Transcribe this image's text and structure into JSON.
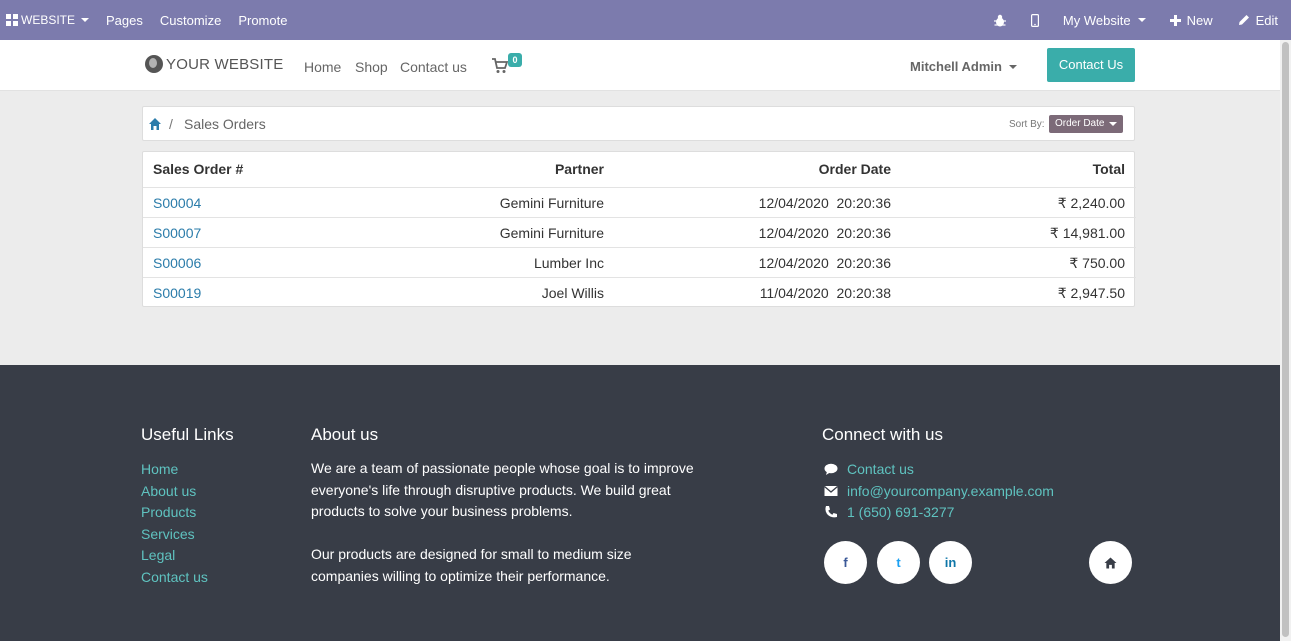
{
  "topbar": {
    "website_menu": "WEBSITE",
    "pages": "Pages",
    "customize": "Customize",
    "promote": "Promote",
    "my_website": "My Website",
    "new": "New",
    "edit": "Edit"
  },
  "header": {
    "logo": "YOUR WEBSITE",
    "nav": [
      "Home",
      "Shop",
      "Contact us"
    ],
    "cart_count": "0",
    "user": "Mitchell Admin",
    "contact_button": "Contact Us"
  },
  "breadcrumb": {
    "separator": "/",
    "current": "Sales Orders",
    "sort_label": "Sort By:",
    "sort_value": "Order Date"
  },
  "orders": {
    "columns": [
      "Sales Order #",
      "Partner",
      "Order Date",
      "Total"
    ],
    "rows": [
      {
        "order": "S00004",
        "partner": "Gemini Furniture",
        "date": "12/04/2020  20:20:36",
        "total": "₹ 2,240.00"
      },
      {
        "order": "S00007",
        "partner": "Gemini Furniture",
        "date": "12/04/2020  20:20:36",
        "total": "₹ 14,981.00"
      },
      {
        "order": "S00006",
        "partner": "Lumber Inc",
        "date": "12/04/2020  20:20:36",
        "total": "₹ 750.00"
      },
      {
        "order": "S00019",
        "partner": "Joel Willis",
        "date": "11/04/2020  20:20:38",
        "total": "₹ 2,947.50"
      }
    ]
  },
  "footer": {
    "useful_links_title": "Useful Links",
    "useful_links": [
      "Home",
      "About us",
      "Products",
      "Services",
      "Legal",
      "Contact us"
    ],
    "about_title": "About us",
    "about_p1_lines": [
      "We are a team of passionate people whose goal is to improve",
      "everyone's life through disruptive products. We build great",
      "products to solve your business problems."
    ],
    "about_p2_lines": [
      "Our products are designed for small to medium size",
      "companies willing to optimize their performance."
    ],
    "connect_title": "Connect with us",
    "contact_link": "Contact us",
    "email": "info@yourcompany.example.com",
    "phone": "1 (650) 691-3277",
    "social": [
      "f",
      "t",
      "in"
    ]
  },
  "colors": {
    "topbar": "#7c7bad",
    "accent": "#3aadaa",
    "footer_bg": "#383d47",
    "link": "#2b7caa"
  }
}
